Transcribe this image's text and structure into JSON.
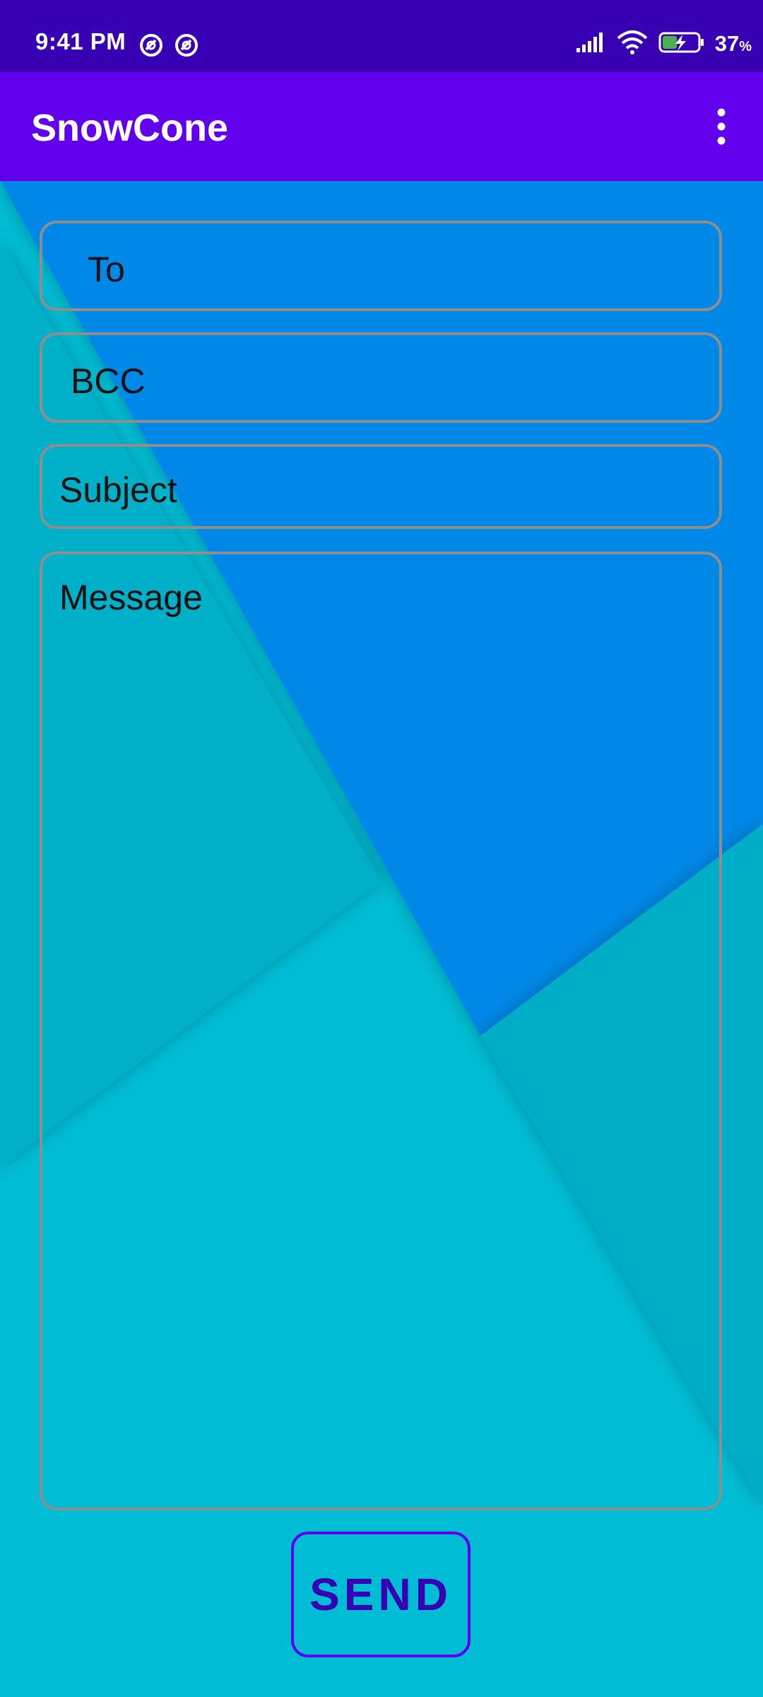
{
  "status_bar": {
    "time": "9:41 PM",
    "battery_percent": "37",
    "battery_percent_sign": "%",
    "icons": [
      "notification-icon",
      "notification-icon",
      "signal-icon",
      "wifi-icon",
      "battery-charging-icon"
    ]
  },
  "app_bar": {
    "title": "SnowCone",
    "menu_icon": "overflow-menu-icon"
  },
  "form": {
    "to_placeholder": "To",
    "bcc_placeholder": "BCC",
    "subject_placeholder": "Subject",
    "message_placeholder": "Message"
  },
  "send_button": {
    "label": "SEND"
  },
  "colors": {
    "status_bar": "#3700b3",
    "app_bar": "#6200ee",
    "field_border": "#8e8e8e",
    "button_border": "#6200ee",
    "button_text": "#3700b3",
    "wallpaper_blue": "#0288e8",
    "wallpaper_cyan": "#00bcd4",
    "wallpaper_teal": "#00adc6"
  }
}
